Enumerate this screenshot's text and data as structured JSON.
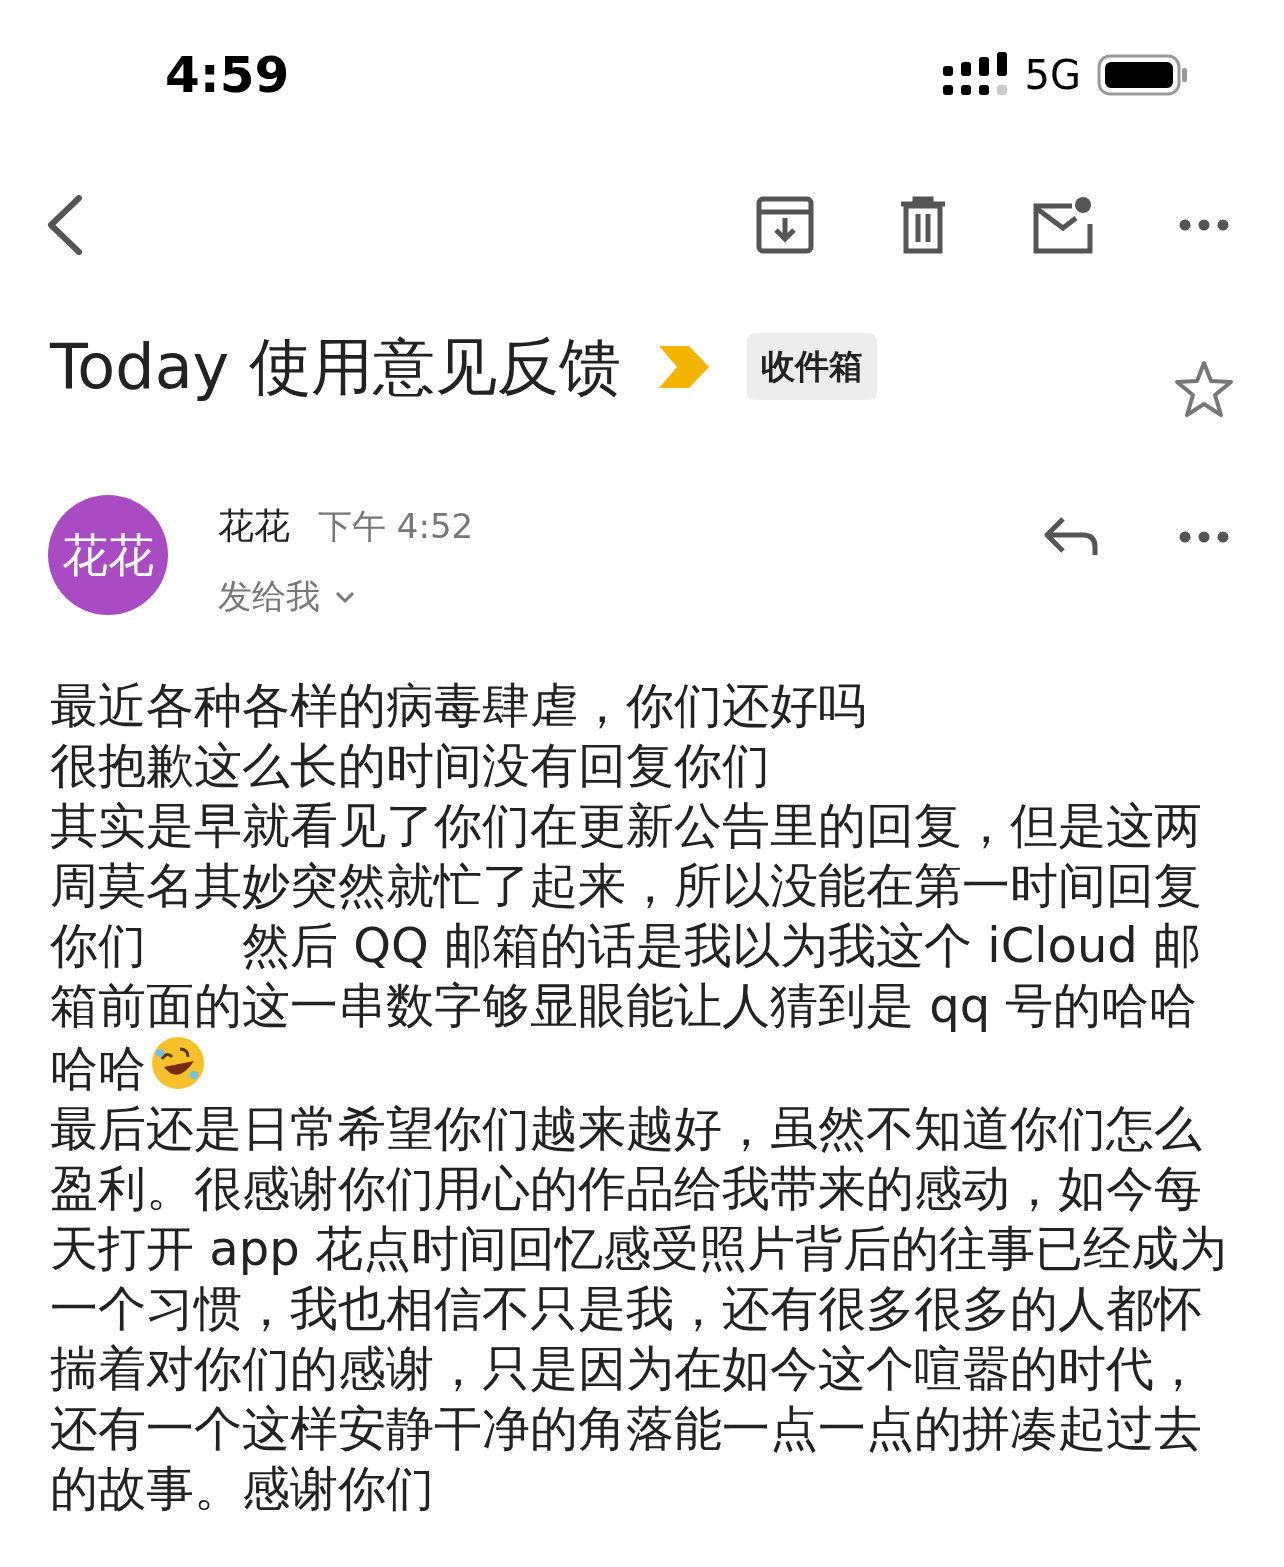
{
  "status_bar": {
    "time": "4:59",
    "network": "5G"
  },
  "subject": {
    "title": "Today 使用意见反馈",
    "important": true,
    "label": "收件箱",
    "starred": false
  },
  "message": {
    "avatar": {
      "text": "花花",
      "color": "#a94cc3"
    },
    "sender": "花花",
    "time": "下午 4:52",
    "recipient": "发给我",
    "paragraphs": [
      {
        "text": "最近各种各样的病毒肆虐，你们还好吗",
        "emoji": false
      },
      {
        "text": "很抱歉这么长的时间没有回复你们",
        "emoji": false
      },
      {
        "text": "其实是早就看见了你们在更新公告里的回复，但是这两周莫名其妙突然就忙了起来，所以没能在第一时间回复你们　　然后 QQ 邮箱的话是我以为我这个 iCloud 邮箱前面的这一串数字够显眼能让人猜到是 qq 号的哈哈哈哈",
        "emoji": true
      },
      {
        "text": "最后还是日常希望你们越来越好，虽然不知道你们怎么盈利。很感谢你们用心的作品给我带来的感动，如今每天打开 app 花点时间回忆感受照片背后的往事已经成为一个习惯，我也相信不只是我，还有很多很多的人都怀揣着对你们的感谢，只是因为在如今这个喧嚣的时代，还有一个这样安静干净的角落能一点一点的拼凑起过去的故事。感谢你们",
        "emoji": false
      }
    ]
  }
}
